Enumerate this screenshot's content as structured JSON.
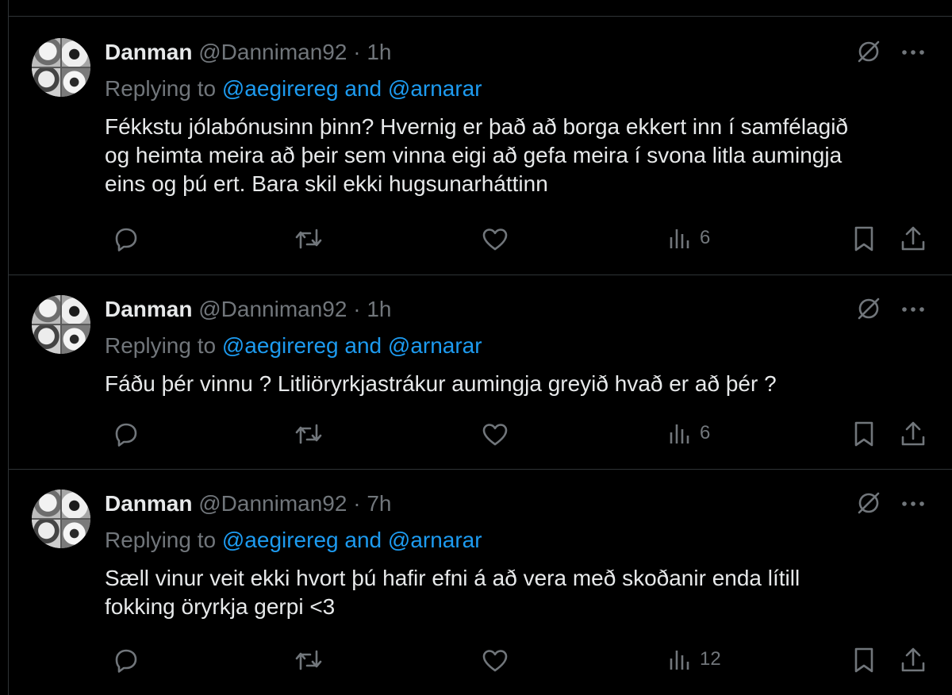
{
  "tweets": [
    {
      "name": "Danman",
      "handle": "@Danniman92",
      "separator": "·",
      "time": "1h",
      "replying_prefix": "Replying to",
      "mention1": "@aegirereg",
      "and": "and",
      "mention2": "@arnarar",
      "lines": [
        "Fékkstu jólabónusinn þinn? Hvernig er það að borga ekkert inn í samfélagið",
        "og heimta meira að þeir sem vinna eigi að gefa meira í svona litla aumingja",
        "eins og þú ert. Bara skil ekki hugsunarháttinn"
      ],
      "views": "6"
    },
    {
      "name": "Danman",
      "handle": "@Danniman92",
      "separator": "·",
      "time": "1h",
      "replying_prefix": "Replying to",
      "mention1": "@aegirereg",
      "and": "and",
      "mention2": "@arnarar",
      "lines": [
        "Fáðu þér vinnu  ? Litliöryrkjastrákur aumingja greyið hvað er að þér ?"
      ],
      "views": "6"
    },
    {
      "name": "Danman",
      "handle": "@Danniman92",
      "separator": "·",
      "time": "7h",
      "replying_prefix": "Replying to",
      "mention1": "@aegirereg",
      "and": "and",
      "mention2": "@arnarar",
      "lines": [
        "Sæll vinur veit ekki hvort þú hafir efni á að vera með skoðanir enda lítill",
        "fokking öryrkja gerpi <3"
      ],
      "views": "12"
    }
  ],
  "icons": {
    "reply": "reply-icon",
    "retweet": "retweet-icon",
    "like": "like-icon",
    "views": "views-icon",
    "bookmark": "bookmark-icon",
    "share": "share-icon",
    "grok": "grok-icon",
    "more": "more-icon"
  },
  "colors": {
    "background": "#000000",
    "text": "#e7e9ea",
    "muted": "#71767b",
    "link": "#1d9bf0",
    "border": "#2f3336"
  }
}
